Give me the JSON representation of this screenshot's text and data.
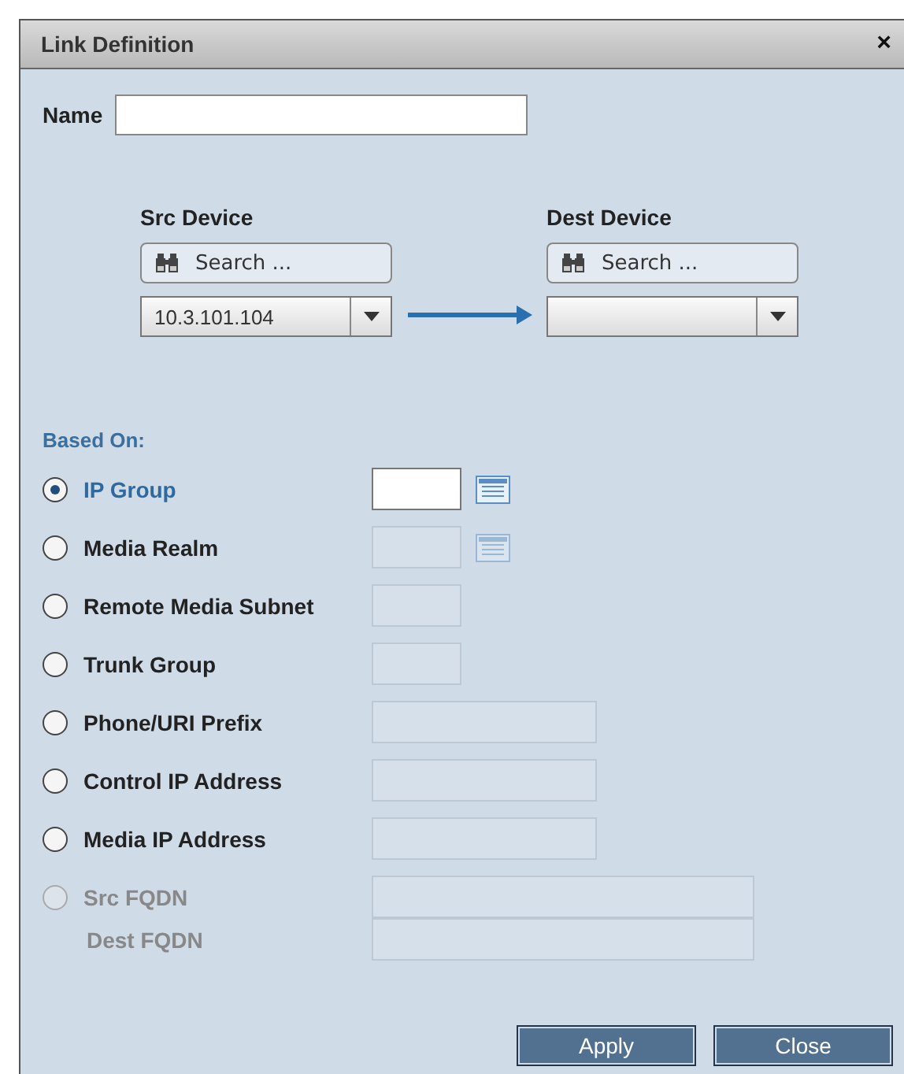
{
  "window": {
    "title": "Link Definition",
    "close": "×"
  },
  "name": {
    "label": "Name"
  },
  "src": {
    "label": "Src Device",
    "search": "Search ...",
    "value": "10.3.101.104"
  },
  "dest": {
    "label": "Dest Device",
    "search": "Search ..."
  },
  "based_on": {
    "title": "Based On:",
    "options": [
      {
        "kind": "short",
        "label": "IP Group",
        "selected": true,
        "disabled": false,
        "list_button": true
      },
      {
        "kind": "short",
        "label": "Media Realm",
        "selected": false,
        "disabled": false,
        "list_button": true
      },
      {
        "kind": "short",
        "label": "Remote Media Subnet",
        "selected": false,
        "disabled": false,
        "list_button": false
      },
      {
        "kind": "short",
        "label": "Trunk Group",
        "selected": false,
        "disabled": false,
        "list_button": false
      },
      {
        "kind": "medium",
        "label": "Phone/URI Prefix",
        "selected": false,
        "disabled": false,
        "list_button": false
      },
      {
        "kind": "medium",
        "label": "Control IP Address",
        "selected": false,
        "disabled": false,
        "list_button": false
      },
      {
        "kind": "medium",
        "label": "Media IP Address",
        "selected": false,
        "disabled": false,
        "list_button": false
      },
      {
        "kind": "wide",
        "label": "Src FQDN",
        "selected": false,
        "disabled": true,
        "list_button": false,
        "sub_label": "Dest FQDN"
      }
    ]
  },
  "buttons": [
    "Apply",
    "Close"
  ]
}
